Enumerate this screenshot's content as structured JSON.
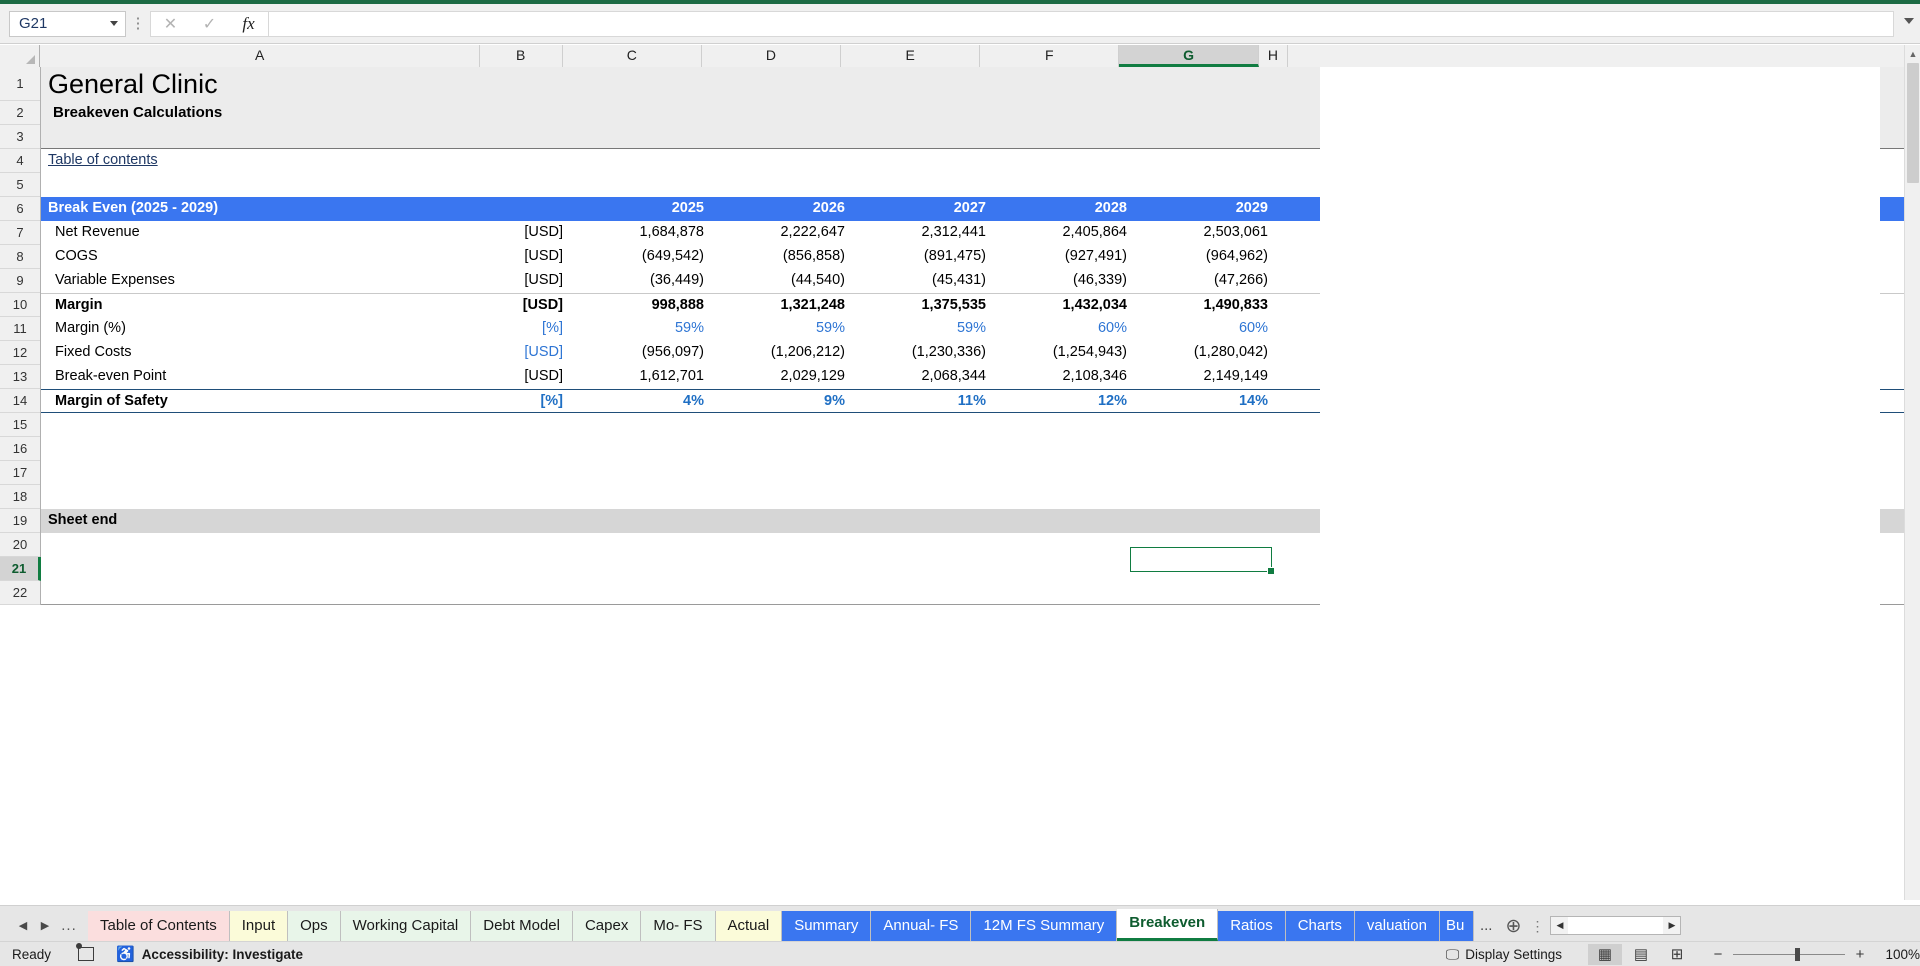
{
  "app": {
    "namebox_value": "G21",
    "formula_value": "",
    "formula_placeholder": ""
  },
  "formula_bar": {
    "cancel_icon": "close-icon",
    "confirm_icon": "check-icon",
    "function_icon": "fx-icon",
    "expand_icon": "chevron-down-icon"
  },
  "grid": {
    "columns": [
      "A",
      "B",
      "C",
      "D",
      "E",
      "F",
      "G",
      "H"
    ],
    "selected_column": "G",
    "rows": [
      "1",
      "2",
      "3",
      "4",
      "5",
      "6",
      "7",
      "8",
      "9",
      "10",
      "11",
      "12",
      "13",
      "14",
      "15",
      "16",
      "17",
      "18",
      "19",
      "20",
      "21",
      "22"
    ],
    "selected_row": "21",
    "selected_cell": "G21"
  },
  "sheet": {
    "title": "General Clinic",
    "subtitle": "Breakeven Calculations",
    "toc_link": "Table of contents",
    "section_header": "Break Even (2025 - 2029)",
    "years": [
      "2025",
      "2026",
      "2027",
      "2028",
      "2029"
    ],
    "sheet_end_label": "Sheet end",
    "rows": [
      {
        "label": "Net Revenue",
        "unit": "[USD]",
        "unit_style": "normal",
        "style": "normal",
        "values": [
          "1,684,878",
          "2,222,647",
          "2,312,441",
          "2,405,864",
          "2,503,061"
        ]
      },
      {
        "label": "COGS",
        "unit": "[USD]",
        "unit_style": "normal",
        "style": "normal",
        "values": [
          "(649,542)",
          "(856,858)",
          "(891,475)",
          "(927,491)",
          "(964,962)"
        ]
      },
      {
        "label": "Variable Expenses",
        "unit": "[USD]",
        "unit_style": "normal",
        "style": "normal",
        "values": [
          "(36,449)",
          "(44,540)",
          "(45,431)",
          "(46,339)",
          "(47,266)"
        ]
      },
      {
        "label": "Margin",
        "unit": "[USD]",
        "unit_style": "bold",
        "style": "bold-total",
        "values": [
          "998,888",
          "1,321,248",
          "1,375,535",
          "1,432,034",
          "1,490,833"
        ]
      },
      {
        "label": "Margin (%)",
        "unit": "[%]",
        "unit_style": "blue",
        "style": "blue",
        "has_comment": true,
        "values": [
          "59%",
          "59%",
          "59%",
          "60%",
          "60%"
        ]
      },
      {
        "label": "Fixed Costs",
        "unit": "[USD]",
        "unit_style": "blue",
        "style": "normal",
        "values": [
          "(956,097)",
          "(1,206,212)",
          "(1,230,336)",
          "(1,254,943)",
          "(1,280,042)"
        ]
      },
      {
        "label": "Break-even Point",
        "unit": "[USD]",
        "unit_style": "normal",
        "style": "normal",
        "values": [
          "1,612,701",
          "2,029,129",
          "2,068,344",
          "2,108,346",
          "2,149,149"
        ]
      },
      {
        "label": "Margin of Safety",
        "unit": "[%]",
        "unit_style": "blue-bold",
        "style": "blue-bold-total",
        "values": [
          "4%",
          "9%",
          "11%",
          "12%",
          "14%"
        ]
      }
    ]
  },
  "tabs": {
    "nav_prev_icon": "triangle-left-icon",
    "nav_next_icon": "triangle-right-icon",
    "nav_more": "...",
    "overflow_more": "...",
    "add_sheet_icon": "plus-circle-icon",
    "items": [
      {
        "label": "Table of Contents",
        "color": "#fbdede",
        "active": false
      },
      {
        "label": "Input",
        "color": "#fbfbd9",
        "active": false
      },
      {
        "label": "Ops",
        "color": "#e8f5e9",
        "active": false
      },
      {
        "label": "Working Capital",
        "color": "#e8f5e9",
        "active": false
      },
      {
        "label": "Debt Model",
        "color": "#e8f5e9",
        "active": false
      },
      {
        "label": "Capex",
        "color": "#e8f5e9",
        "active": false
      },
      {
        "label": "Mo- FS",
        "color": "#e8f5e9",
        "active": false
      },
      {
        "label": "Actual",
        "color": "#fbfbd9",
        "active": false
      },
      {
        "label": "Summary",
        "color": "#3a76f0",
        "active": false,
        "text_color": "#ffffff"
      },
      {
        "label": "Annual- FS",
        "color": "#3a76f0",
        "active": false,
        "text_color": "#ffffff"
      },
      {
        "label": "12M FS Summary",
        "color": "#3a76f0",
        "active": false,
        "text_color": "#ffffff"
      },
      {
        "label": "Breakeven",
        "color": "#ffffff",
        "active": true
      },
      {
        "label": "Ratios",
        "color": "#3a76f0",
        "active": false,
        "text_color": "#ffffff"
      },
      {
        "label": "Charts",
        "color": "#3a76f0",
        "active": false,
        "text_color": "#ffffff"
      },
      {
        "label": "valuation",
        "color": "#3a76f0",
        "active": false,
        "text_color": "#ffffff"
      },
      {
        "label": "Bu",
        "color": "#3a76f0",
        "active": false,
        "text_color": "#ffffff"
      }
    ]
  },
  "status": {
    "ready": "Ready",
    "accessibility": "Accessibility: Investigate",
    "display_settings": "Display Settings",
    "zoom_level": "100%",
    "zoom_out_label": "−",
    "zoom_in_label": "+",
    "view_normal_icon": "grid-view-icon",
    "view_layout_icon": "page-layout-icon",
    "view_break_icon": "page-break-icon"
  },
  "colors": {
    "accent_blue": "#3a76f0",
    "excel_green": "#107c41",
    "link_blue": "#1f3864",
    "input_blue": "#2e75d4"
  }
}
